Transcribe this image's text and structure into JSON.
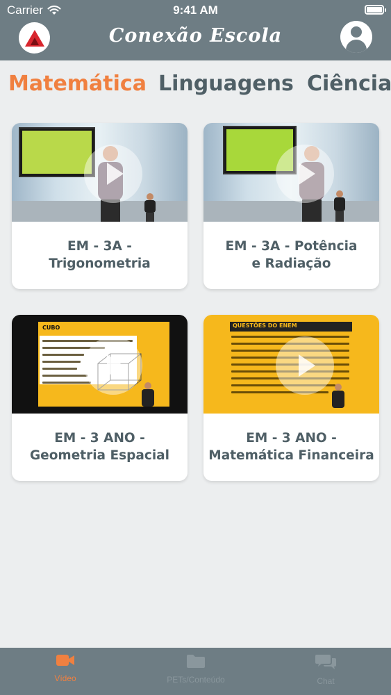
{
  "status_bar": {
    "carrier": "Carrier",
    "time": "9:41 AM"
  },
  "header": {
    "title": "Conexão Escola",
    "logo_icon": "school-logo-icon",
    "profile_icon": "user-icon"
  },
  "subject_tabs": [
    {
      "label": "Matemática",
      "active": true
    },
    {
      "label": "Linguagens",
      "active": false
    },
    {
      "label": "Ciências",
      "active": false
    }
  ],
  "videos": [
    {
      "title": "EM - 3A - Trigonometria",
      "thumb": "studio"
    },
    {
      "title": "EM - 3A - Potência\ne Radiação",
      "thumb": "studio"
    },
    {
      "title": "EM - 3 ANO -\nGeometria Espacial",
      "thumb": "slide"
    },
    {
      "title": "EM - 3 ANO -\nMatemática Financeira",
      "thumb": "slide"
    }
  ],
  "slides": {
    "cubo_header": "CUBO",
    "enem_header": "QUESTÕES DO ENEM"
  },
  "bottom_tabs": [
    {
      "label": "Vídeo",
      "icon": "video-camera-icon",
      "active": true
    },
    {
      "label": "PETs/Conteúdo",
      "icon": "folder-icon",
      "active": false
    },
    {
      "label": "Chat",
      "icon": "chat-bubbles-icon",
      "active": false
    }
  ],
  "colors": {
    "header": "#6e7d84",
    "accent": "#f08040",
    "tab_text": "#4f5f66",
    "background": "#eceeef"
  }
}
